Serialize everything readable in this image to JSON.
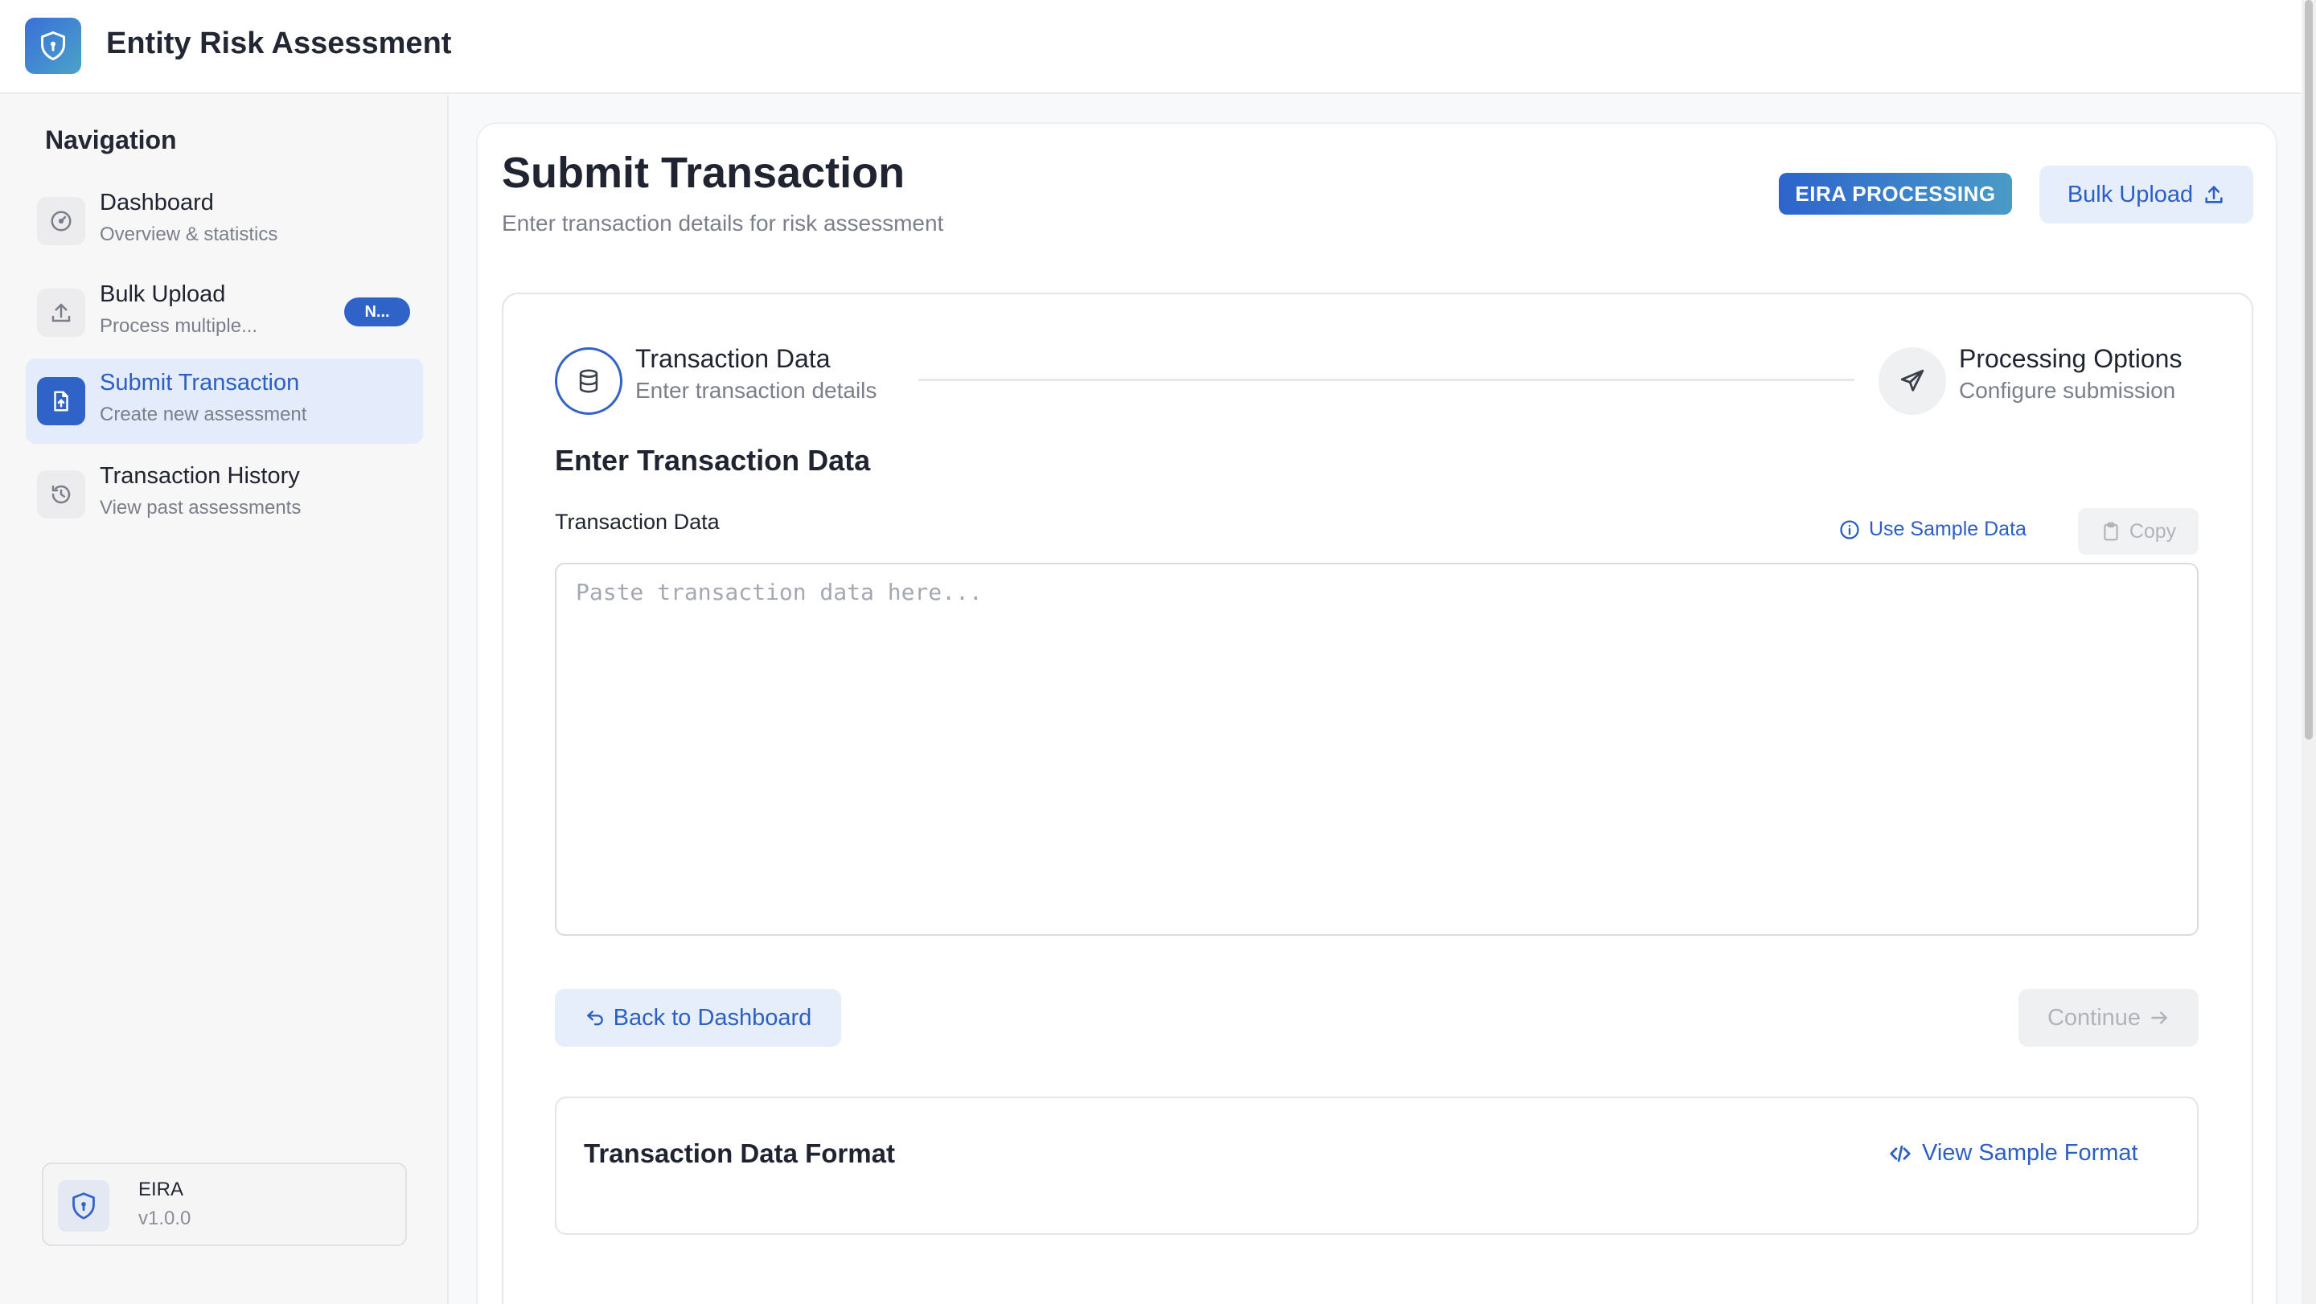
{
  "app": {
    "title": "Entity Risk Assessment",
    "logo_icon": "shield-icon",
    "accent_color": "#2f63c7"
  },
  "sidebar": {
    "heading": "Navigation",
    "items": [
      {
        "title": "Dashboard",
        "subtitle": "Overview & statistics",
        "icon": "gauge-icon",
        "active": false
      },
      {
        "title": "Bulk Upload",
        "subtitle": "Process multiple...",
        "icon": "upload-icon",
        "badge": "N...",
        "active": false
      },
      {
        "title": "Submit Transaction",
        "subtitle": "Create new assessment",
        "icon": "file-upload-icon",
        "active": true
      },
      {
        "title": "Transaction History",
        "subtitle": "View past assessments",
        "icon": "history-icon",
        "active": false
      }
    ],
    "footer": {
      "name": "EIRA",
      "version": "v1.0.0",
      "icon": "shield-icon"
    }
  },
  "page": {
    "title": "Submit Transaction",
    "subtitle": "Enter transaction details for risk assessment",
    "badge": "EIRA PROCESSING",
    "bulk_upload_label": "Bulk Upload"
  },
  "stepper": {
    "steps": [
      {
        "title": "Transaction Data",
        "subtitle": "Enter transaction details",
        "icon": "database-icon",
        "active": true
      },
      {
        "title": "Processing Options",
        "subtitle": "Configure submission",
        "icon": "send-icon",
        "active": false
      }
    ]
  },
  "form": {
    "section_title": "Enter Transaction Data",
    "field_label": "Transaction Data",
    "sample_link": "Use Sample Data",
    "copy_label": "Copy",
    "textarea_value": "",
    "textarea_placeholder": "Paste transaction data here...",
    "back_label": "Back to Dashboard",
    "continue_label": "Continue"
  },
  "format_card": {
    "title": "Transaction Data Format",
    "link": "View Sample Format"
  }
}
